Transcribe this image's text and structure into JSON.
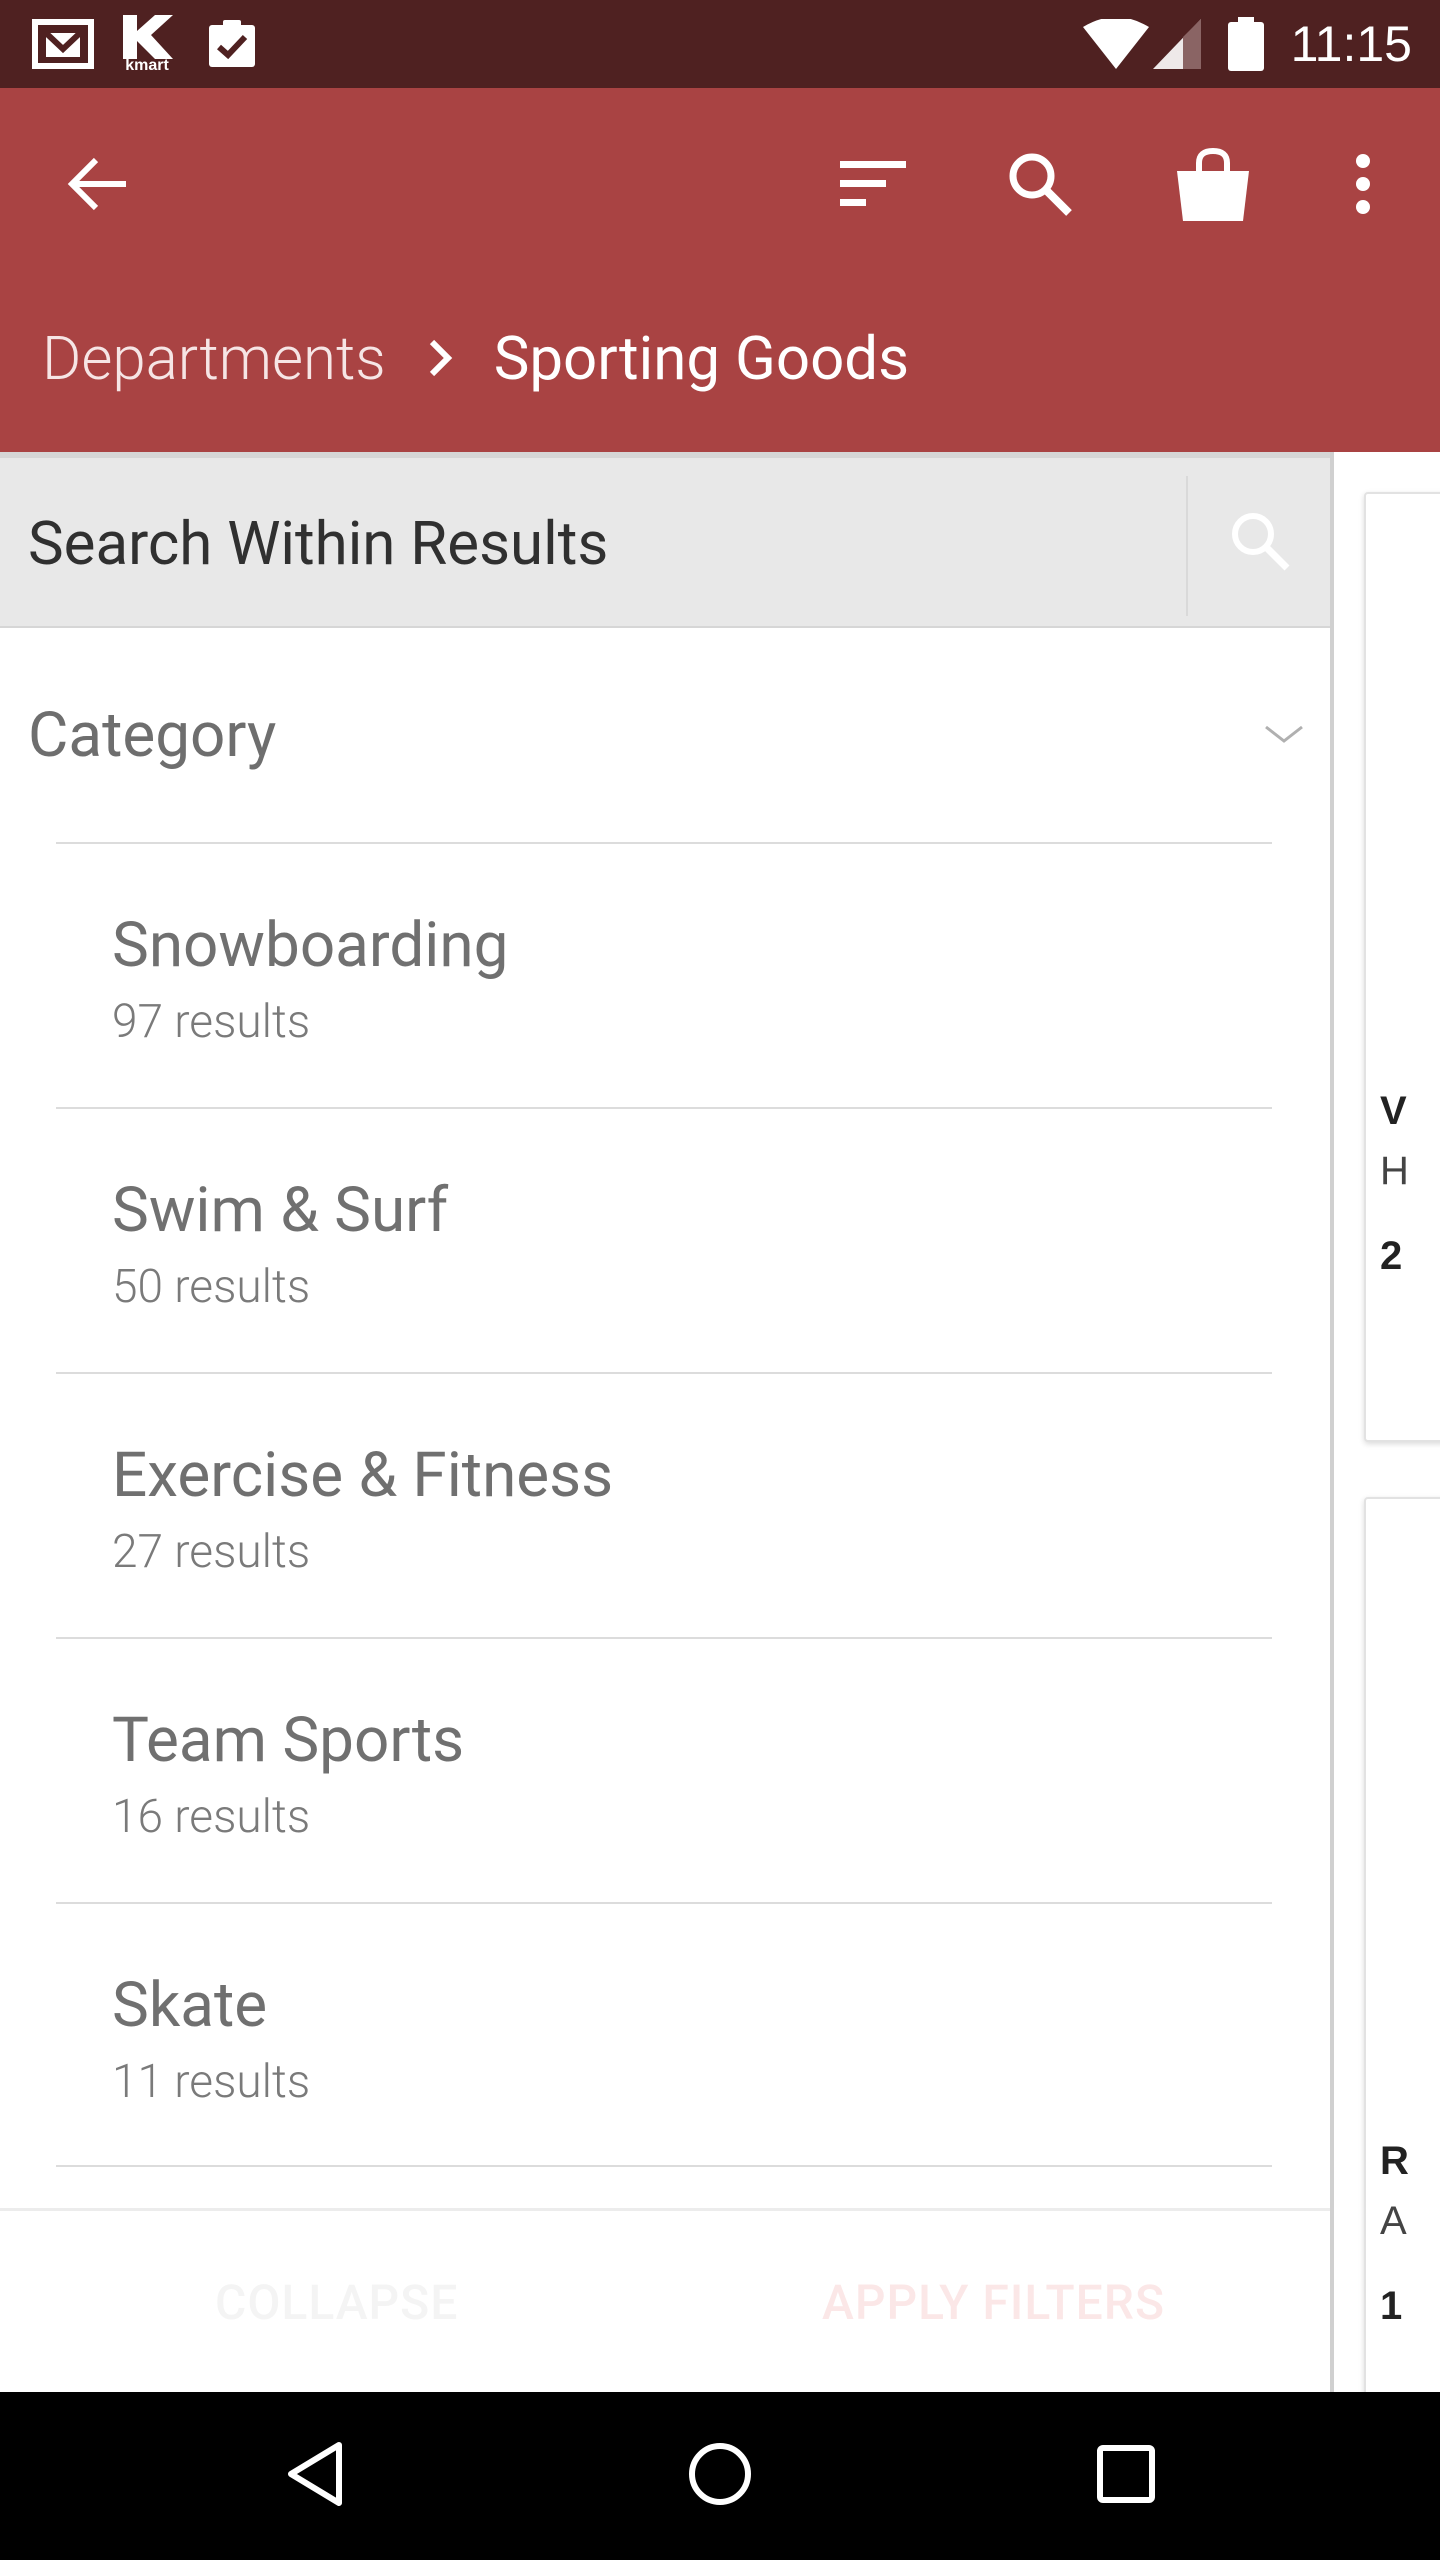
{
  "status_bar": {
    "time": "11:15",
    "notification_icons": [
      "gmail-icon",
      "kmart-icon",
      "clipboard-check-icon"
    ],
    "system_icons": [
      "wifi-icon",
      "signal-icon",
      "battery-icon"
    ],
    "kmart_label": "kmart"
  },
  "app_bar": {
    "back_icon": "arrow-back-icon",
    "actions": [
      "sort-icon",
      "search-icon",
      "shopping-bag-icon",
      "more-vert-icon"
    ],
    "breadcrumb": {
      "parent": "Departments",
      "current": "Sporting Goods"
    }
  },
  "filter_panel": {
    "search": {
      "placeholder": "Search Within Results",
      "value": ""
    },
    "category": {
      "title": "Category",
      "expanded": true,
      "items": [
        {
          "label": "Snowboarding",
          "count": "97 results"
        },
        {
          "label": "Swim & Surf",
          "count": "50 results"
        },
        {
          "label": "Exercise & Fitness",
          "count": "27 results"
        },
        {
          "label": "Team Sports",
          "count": "16 results"
        },
        {
          "label": "Skate",
          "count": "11 results"
        }
      ]
    },
    "footer": {
      "collapse_label": "COLLAPSE",
      "apply_label": "APPLY FILTERS"
    }
  },
  "results_peek": {
    "card1": {
      "line1": "V",
      "line2": "H",
      "line3": "2"
    },
    "card2": {
      "line1": "R",
      "line2": "A",
      "line3": "1"
    }
  },
  "nav_bar": {
    "buttons": [
      "back-triangle-icon",
      "home-circle-icon",
      "recents-square-icon"
    ]
  },
  "colors": {
    "status_bar": "#4f2121",
    "app_bar": "#a94343",
    "search_bg": "#e8e8e8",
    "nav_bar": "#000000"
  }
}
